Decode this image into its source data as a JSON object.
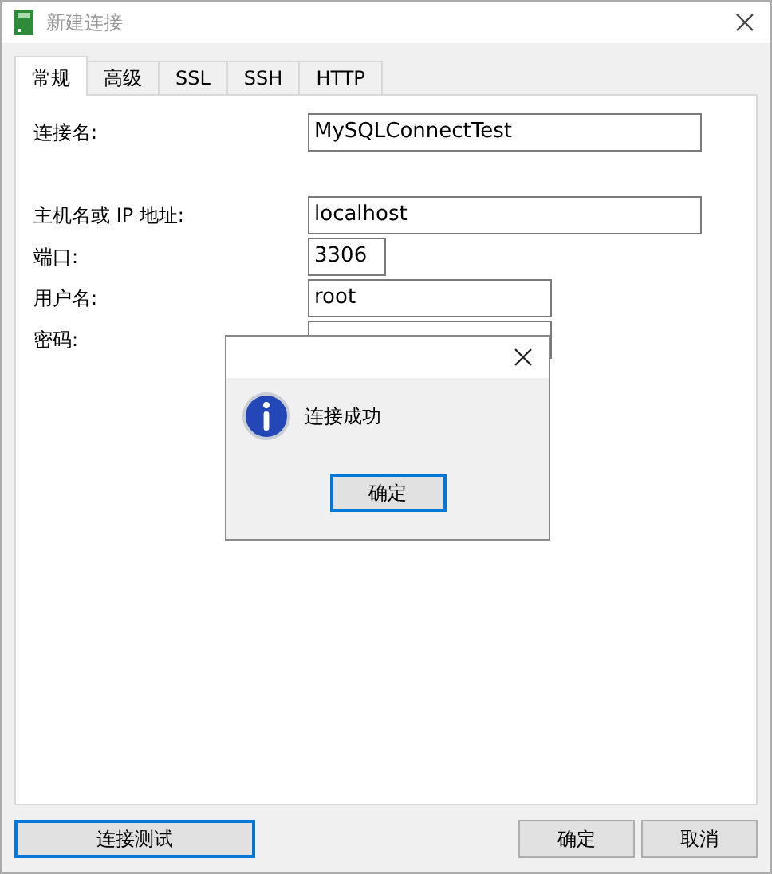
{
  "window": {
    "title": "新建连接"
  },
  "tabs": [
    {
      "label": "常规",
      "selected": true
    },
    {
      "label": "高级",
      "selected": false
    },
    {
      "label": "SSL",
      "selected": false
    },
    {
      "label": "SSH",
      "selected": false
    },
    {
      "label": "HTTP",
      "selected": false
    }
  ],
  "fields": [
    {
      "label": "连接名:",
      "value": "MySQLConnectTest",
      "kind": "wide"
    },
    {
      "label": "主机名或 IP 地址:",
      "value": "localhost",
      "kind": "wide"
    },
    {
      "label": "端口:",
      "value": "3306",
      "kind": "short"
    },
    {
      "label": "用户名:",
      "value": "root",
      "kind": "medium"
    },
    {
      "label": "密码:",
      "kind": "medium"
    }
  ],
  "footer_buttons": [
    {
      "label": "连接测试",
      "focused": true
    },
    {
      "label": "确定",
      "focused": false
    },
    {
      "label": "取消",
      "focused": false
    }
  ],
  "message_box": {
    "message": "连接成功",
    "button": {
      "label": "确定",
      "focused": true
    }
  }
}
